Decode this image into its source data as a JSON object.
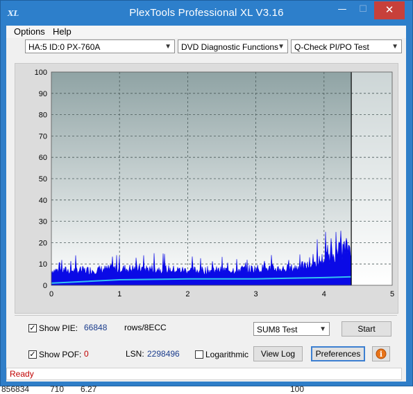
{
  "window": {
    "app_icon": "XL",
    "title": "PlexTools Professional XL V3.16",
    "controls": {
      "minimize": "—",
      "maximize": "☐",
      "close": "✕"
    }
  },
  "menu": {
    "items": [
      {
        "label": "Options",
        "accel": "O"
      },
      {
        "label": "Help",
        "accel": "H"
      }
    ]
  },
  "toolbar": {
    "drive": "HA:5 ID:0  PX-760A",
    "function": "DVD Diagnostic Functions",
    "test": "Q-Check PI/PO Test"
  },
  "chart_data": {
    "type": "area",
    "y_ticks": [
      "100",
      "90",
      "80",
      "70",
      "60",
      "50",
      "40",
      "30",
      "20",
      "10",
      "0"
    ],
    "x_ticks": [
      "0",
      "1",
      "2",
      "3",
      "4",
      "5"
    ],
    "xlim": [
      0,
      5
    ],
    "ylim": [
      0,
      100
    ],
    "grid": true,
    "end_marker_x": 4.4,
    "colors": {
      "pie_fill": "#0a0ae6",
      "pie_line": "#33c3f0",
      "bg_top": "#8fa3a4",
      "bg_bottom": "#ffffff",
      "grid": "#4a5a5a"
    },
    "pie_profile": [
      [
        0,
        9
      ],
      [
        0.5,
        9
      ],
      [
        1,
        10
      ],
      [
        1.5,
        10
      ],
      [
        2,
        9
      ],
      [
        2.5,
        9
      ],
      [
        3,
        10
      ],
      [
        3.5,
        10
      ],
      [
        3.8,
        12
      ],
      [
        4,
        16
      ],
      [
        4.2,
        20
      ],
      [
        4.4,
        24
      ]
    ],
    "pie_avg_line": [
      [
        0,
        1
      ],
      [
        1,
        2.6
      ],
      [
        2,
        3
      ],
      [
        3,
        3
      ],
      [
        3.5,
        3.3
      ],
      [
        4,
        3.6
      ],
      [
        4.4,
        4
      ]
    ]
  },
  "controls": {
    "show_pie_label": "Show PIE:",
    "show_pie_checked": "✓",
    "pie_value": "66848",
    "pie_unit": "rows/8ECC",
    "sum_select": "SUM8 Test",
    "start_label": "Start",
    "show_pof_label": "Show POF:",
    "show_pof_checked": "✓",
    "pof_value": "0",
    "lsn_label": "LSN:",
    "lsn_value": "2298496",
    "log_label": "Logarithmic",
    "view_log_label": "View Log",
    "preferences_label": "Preferences",
    "info_icon": "i"
  },
  "status": {
    "text": "Ready"
  },
  "background_strip": [
    "856834",
    "710",
    "6.27",
    "100"
  ]
}
